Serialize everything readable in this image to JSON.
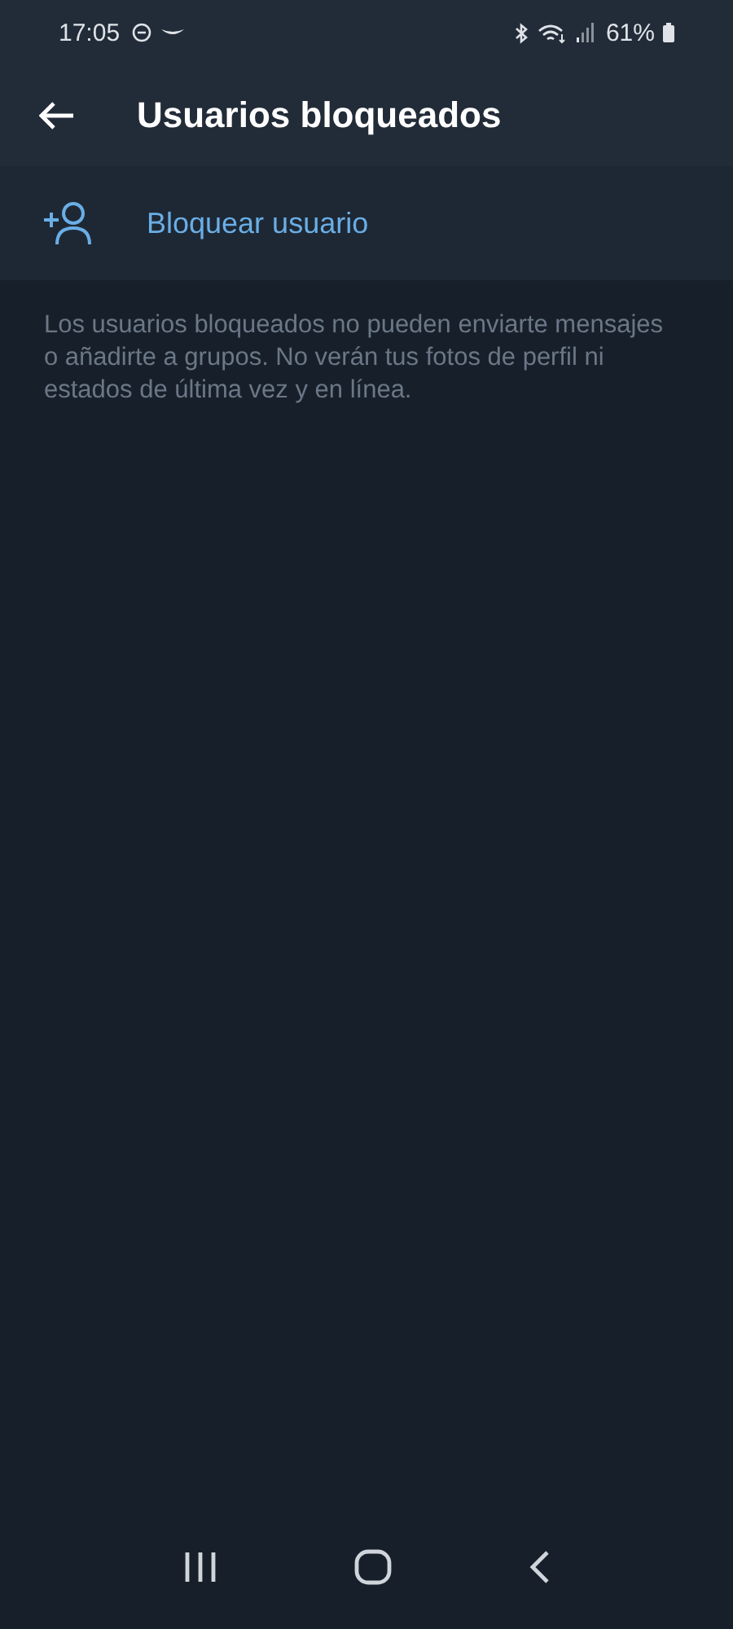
{
  "status_bar": {
    "time": "17:05",
    "battery": "61%"
  },
  "header": {
    "title": "Usuarios bloqueados"
  },
  "action": {
    "label": "Bloquear usuario"
  },
  "description": "Los usuarios bloqueados no pueden enviarte mensajes o añadirte a grupos. No verán tus fotos de perfil ni estados de última vez y en línea."
}
